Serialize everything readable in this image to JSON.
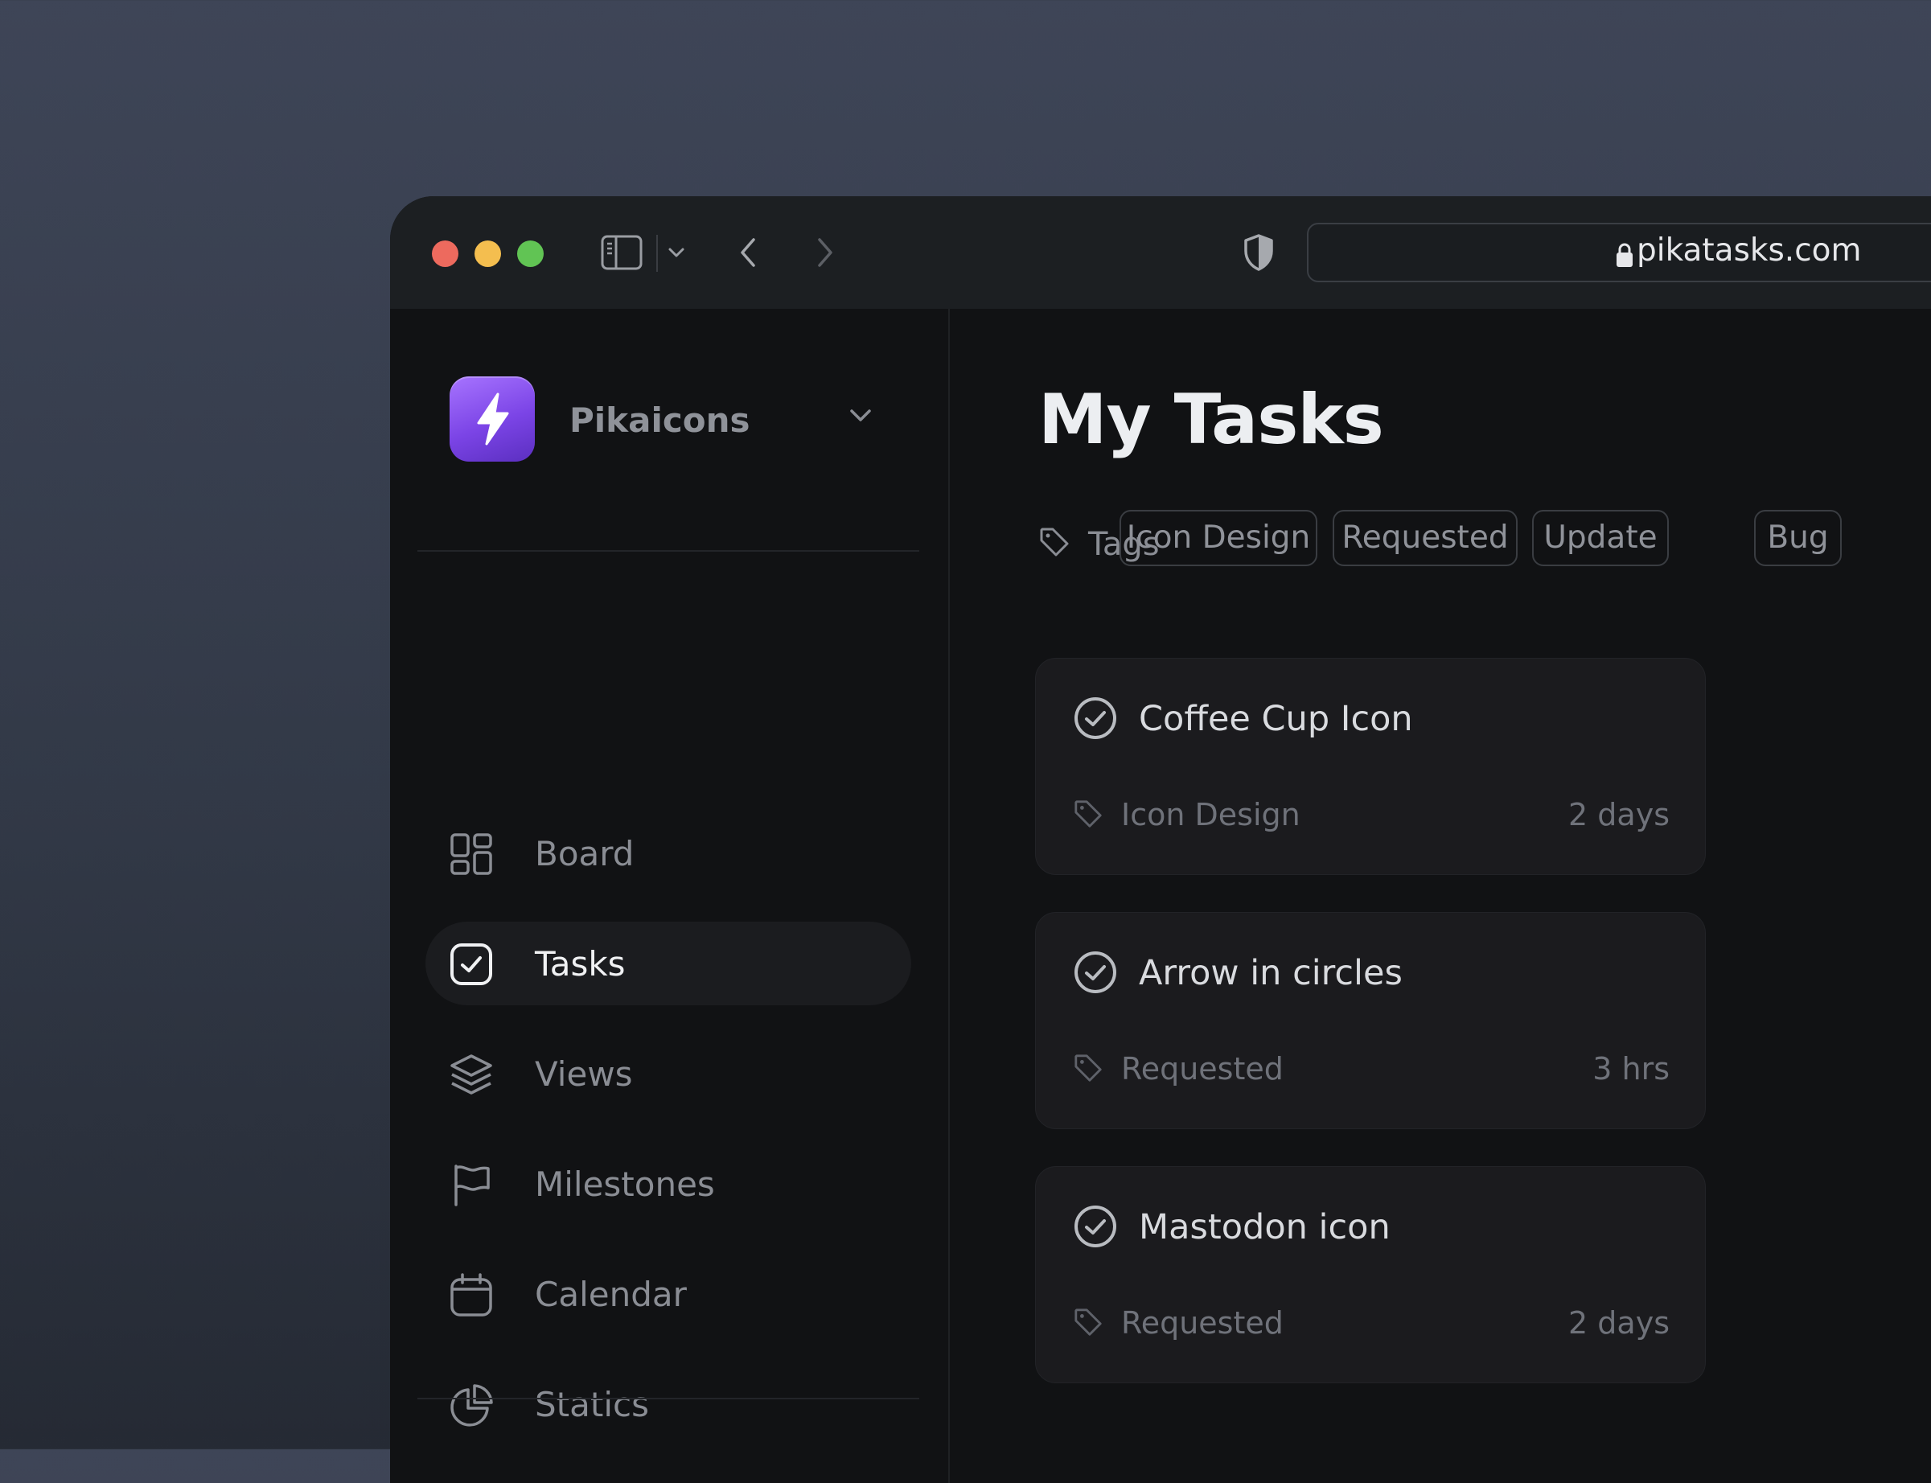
{
  "browser": {
    "url": "pikatasks.com",
    "icons": {
      "sidebar_toggle": "sidebar-toggle-icon",
      "dropdown": "chevron-down-icon",
      "back": "chevron-left-icon",
      "forward": "chevron-right-icon",
      "privacy": "shield-icon",
      "lock": "lock-icon"
    },
    "traffic_colors": {
      "close": "#ed6a5e",
      "minimize": "#f4be4f",
      "maximize": "#61c454"
    }
  },
  "sidebar": {
    "workspace_name": "Pikaicons",
    "brand_colors": [
      "#a774ff",
      "#5b2fc0"
    ],
    "items": [
      {
        "label": "Board",
        "icon": "board-grid-icon",
        "active": false
      },
      {
        "label": "Tasks",
        "icon": "checkbox-icon",
        "active": true
      },
      {
        "label": "Views",
        "icon": "layers-icon",
        "active": false
      },
      {
        "label": "Milestones",
        "icon": "flag-icon",
        "active": false
      },
      {
        "label": "Calendar",
        "icon": "calendar-icon",
        "active": false
      },
      {
        "label": "Statics",
        "icon": "pie-chart-icon",
        "active": false
      }
    ]
  },
  "main": {
    "title": "My Tasks",
    "tags_label": "Tags",
    "tags": [
      "Icon Design",
      "Requested",
      "Update",
      "Bug"
    ],
    "tasks": [
      {
        "title": "Coffee Cup Icon",
        "tag": "Icon Design",
        "time": "2 days"
      },
      {
        "title": "Arrow in circles",
        "tag": "Requested",
        "time": "3 hrs"
      },
      {
        "title": "Mastodon icon",
        "tag": "Requested",
        "time": "2 days"
      }
    ]
  }
}
